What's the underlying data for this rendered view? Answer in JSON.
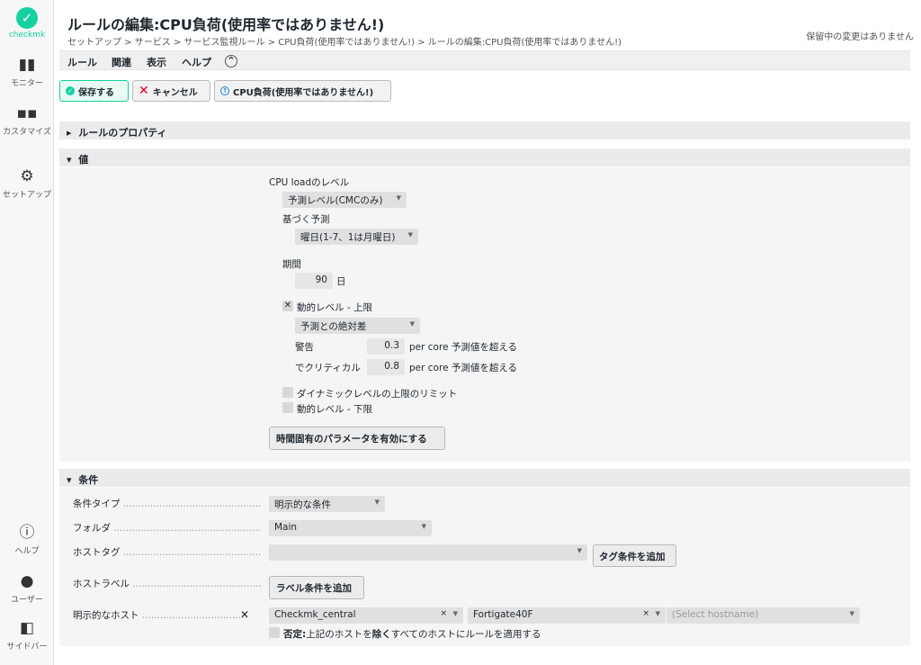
{
  "nav": {
    "logo": "checkmk",
    "items": [
      {
        "label": "モニター",
        "icon": "bar-chart-icon"
      },
      {
        "label": "カスタマイズ",
        "icon": "grid-icon"
      },
      {
        "label": "セットアップ",
        "icon": "gear-icon"
      },
      {
        "label": "ヘルプ",
        "icon": "info-icon"
      },
      {
        "label": "ユーザー",
        "icon": "user-icon"
      },
      {
        "label": "サイドバー",
        "icon": "sidebar-icon"
      }
    ]
  },
  "header": {
    "title": "ルールの編集:CPU負荷(使用率ではありません!)",
    "breadcrumb": "セットアップ > サービス > サービス監視ルール > CPU負荷(使用率ではありません!) > ルールの編集:CPU負荷(使用率ではありません!)",
    "pending": "保留中の変更はありません"
  },
  "menu": {
    "rule": "ルール",
    "related": "関連",
    "display": "表示",
    "help": "ヘルプ",
    "chevron": "⌃"
  },
  "toolbar": {
    "save": "保存する",
    "cancel": "キャンセル",
    "cpu": "CPU負荷(使用率ではありません!)"
  },
  "sections": {
    "properties": "ルールのプロパティ",
    "value": "値",
    "conditions": "条件"
  },
  "value": {
    "cpu_level_label": "CPU loadのレベル",
    "level_select": "予測レベル(CMCのみ)",
    "based_on_label": "基づく予測",
    "based_on_select": "曜日(1-7、1は月曜日)",
    "period_label": "期間",
    "period_value": "90",
    "period_unit": "日",
    "upper_dynamic_label": "動的レベル - 上限",
    "upper_select": "予測との絶対差",
    "warn_label": "警告",
    "warn_value": "0.3",
    "crit_label": "でクリティカル",
    "crit_value": "0.8",
    "per_core_suffix": "per core 予測値を超える",
    "upper_limit_label": "ダイナミックレベルの上限のリミット",
    "lower_dynamic_label": "動的レベル - 下限",
    "time_specific_button": "時間固有のパラメータを有効にする"
  },
  "conditions": {
    "type_label": "条件タイプ",
    "type_value": "明示的な条件",
    "folder_label": "フォルダ",
    "folder_value": "Main",
    "hosttag_label": "ホストタグ",
    "add_tag_button": "タグ条件を追加",
    "hostlabel_label": "ホストラベル",
    "add_label_button": "ラベル条件を追加",
    "explicit_hosts_label": "明示的なホスト",
    "hosts": [
      "Checkmk_central",
      "Fortigate40F"
    ],
    "host_placeholder": "(Select hostname)",
    "negate_prefix": "否定:",
    "negate_text_1": "上記のホストを",
    "negate_bold": "除く",
    "negate_text_2": "すべてのホストにルールを適用する"
  }
}
